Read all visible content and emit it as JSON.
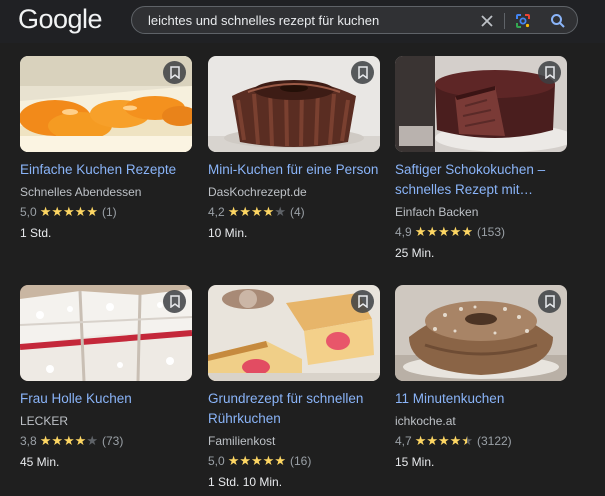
{
  "header": {
    "logo": "Google",
    "search": {
      "value": "leichtes und schnelles rezept für kuchen",
      "placeholder": ""
    }
  },
  "cards": [
    {
      "title": "Einfache Kuchen Rezepte",
      "source": "Schnelles Abendessen",
      "score": "5,0",
      "rating": 5.0,
      "count": "(1)",
      "time": "1 Std.",
      "image": "orange-cream-cake-photo"
    },
    {
      "title": "Mini-Kuchen für eine Person",
      "source": "DasKochrezept.de",
      "score": "4,2",
      "rating": 4.2,
      "count": "(4)",
      "time": "10 Min.",
      "image": "chocolate-bundt-cake-photo"
    },
    {
      "title": "Saftiger Schokokuchen – schnelles Rezept mit…",
      "source": "Einfach Backen",
      "score": "4,9",
      "rating": 4.9,
      "count": "(153)",
      "time": "25 Min.",
      "image": "chocolate-cake-slice-photo"
    },
    {
      "title": "Frau Holle Kuchen",
      "source": "LECKER",
      "score": "3,8",
      "rating": 3.8,
      "count": "(73)",
      "time": "45 Min.",
      "image": "cream-cherry-sheet-cake-photo"
    },
    {
      "title": "Grundrezept für schnellen Rührkuchen",
      "source": "Familienkost",
      "score": "5,0",
      "rating": 5.0,
      "count": "(16)",
      "time": "1 Std. 10 Min.",
      "image": "heart-loaf-cake-photo"
    },
    {
      "title": "11 Minutenkuchen",
      "source": "ichkoche.at",
      "score": "4,7",
      "rating": 4.7,
      "count": "(3122)",
      "time": "15 Min.",
      "image": "sugar-dusted-bundt-cake-photo"
    }
  ],
  "colors": {
    "background": "#1f1f1f",
    "link": "#8ab4f8",
    "star": "#fdd663"
  }
}
